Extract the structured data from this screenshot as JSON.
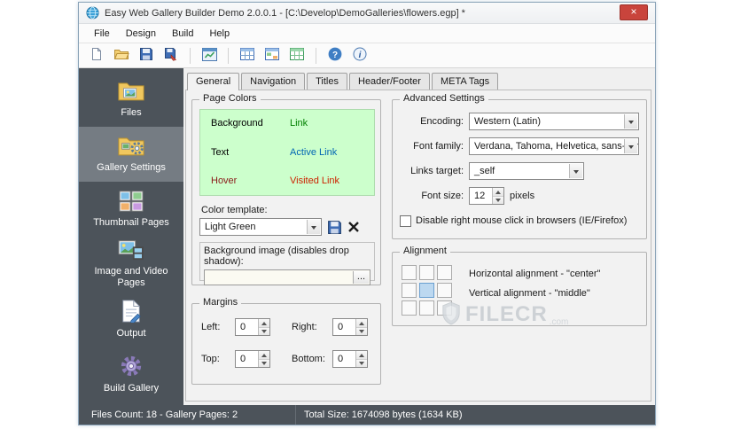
{
  "window": {
    "title": "Easy Web Gallery Builder Demo 2.0.0.1 - [C:\\Develop\\DemoGalleries\\flowers.egp] *",
    "close_label": "×"
  },
  "menu": {
    "items": [
      "File",
      "Design",
      "Build",
      "Help"
    ]
  },
  "toolbar": {
    "icons": [
      "new-project",
      "open-project",
      "save-project",
      "export-project",
      "build-preview",
      "files-table",
      "pages-table",
      "gallery-table",
      "help",
      "about"
    ]
  },
  "sidebar": {
    "items": [
      {
        "label": "Files",
        "selected": false
      },
      {
        "label": "Gallery Settings",
        "selected": true
      },
      {
        "label": "Thumbnail Pages",
        "selected": false
      },
      {
        "label": "Image and Video Pages",
        "selected": false
      },
      {
        "label": "Output",
        "selected": false
      },
      {
        "label": "Build Gallery",
        "selected": false
      }
    ]
  },
  "tabs": {
    "items": [
      "General",
      "Navigation",
      "Titles",
      "Header/Footer",
      "META Tags"
    ],
    "active": "General"
  },
  "page_colors": {
    "group_label": "Page Colors",
    "items": [
      {
        "label": "Background",
        "color": "#000000"
      },
      {
        "label": "Link",
        "color": "#008000"
      },
      {
        "label": "Text",
        "color": "#000000"
      },
      {
        "label": "Active Link",
        "color": "#0066b3"
      },
      {
        "label": "Hover",
        "color": "#8b1a1a"
      },
      {
        "label": "Visited Link",
        "color": "#cc2200"
      }
    ],
    "template_label": "Color template:",
    "template_value": "Light Green",
    "background_image_label": "Background image (disables drop shadow):",
    "background_image_value": "",
    "browse_label": "..."
  },
  "margins": {
    "group_label": "Margins",
    "fields": [
      {
        "label": "Left:",
        "value": "0"
      },
      {
        "label": "Right:",
        "value": "0"
      },
      {
        "label": "Top:",
        "value": "0"
      },
      {
        "label": "Bottom:",
        "value": "0"
      }
    ]
  },
  "advanced": {
    "group_label": "Advanced Settings",
    "encoding_label": "Encoding:",
    "encoding_value": "Western (Latin)",
    "font_family_label": "Font family:",
    "font_family_value": "Verdana, Tahoma, Helvetica, sans-seri",
    "links_target_label": "Links target:",
    "links_target_value": "_self",
    "font_size_label": "Font size:",
    "font_size_value": "12",
    "font_size_unit": "pixels",
    "right_click_label": "Disable right mouse click in browsers (IE/Firefox)",
    "right_click_checked": false
  },
  "alignment": {
    "group_label": "Alignment",
    "horizontal_text": "Horizontal alignment - \"center\"",
    "vertical_text": "Vertical alignment - \"middle\"",
    "selected_cell": "center-middle"
  },
  "watermark": {
    "name": "FILECR",
    "domain": ".com"
  },
  "statusbar": {
    "left": "Files Count: 18 - Gallery Pages: 2",
    "right": "Total Size: 1674098 bytes (1634 KB)"
  },
  "colors": {
    "sidebar_bg": "#4c535a",
    "sidebar_selected": "#757c83",
    "statusbar_bg": "#4c535a",
    "preview_bg": "#ccffcc",
    "close_button": "#c9443c",
    "alignment_selected": "#bcd8f0"
  }
}
